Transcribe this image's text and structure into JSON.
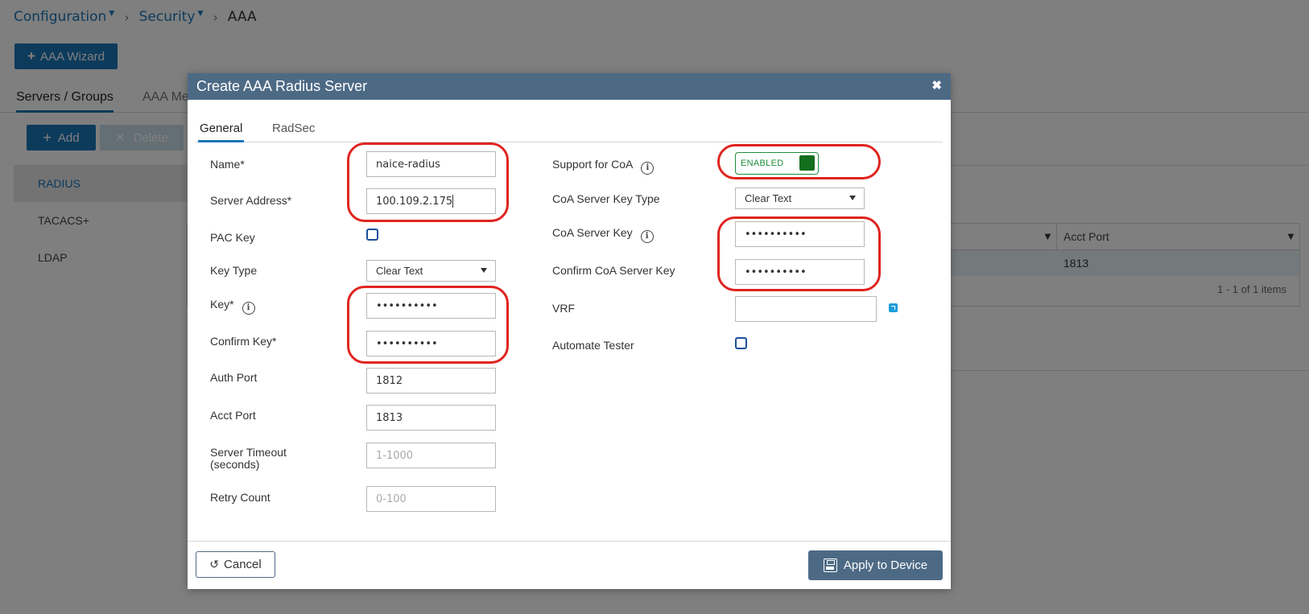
{
  "breadcrumb": {
    "items": [
      {
        "label": "Configuration"
      },
      {
        "label": "Security"
      }
    ],
    "current": "AAA"
  },
  "toolbar": {
    "wizard_label": "AAA Wizard"
  },
  "main_tabs": [
    {
      "label": "Servers / Groups"
    },
    {
      "label": "AAA Me"
    }
  ],
  "actions": {
    "add_label": "Add",
    "delete_label": "Delete"
  },
  "sidebar": {
    "items": [
      {
        "label": "RADIUS"
      },
      {
        "label": "TACACS+"
      },
      {
        "label": "LDAP"
      }
    ]
  },
  "grid": {
    "columns": [
      "Acct Port"
    ],
    "rows": [
      {
        "acct_port": "1813"
      }
    ],
    "pager": "1 - 1 of 1 items"
  },
  "modal": {
    "title": "Create AAA Radius Server",
    "tabs": [
      {
        "label": "General"
      },
      {
        "label": "RadSec"
      }
    ],
    "fields": {
      "name": {
        "label": "Name*",
        "value": "naice-radius"
      },
      "server_address": {
        "label": "Server Address*",
        "value": "100.109.2.175"
      },
      "pac_key": {
        "label": "PAC Key"
      },
      "key_type": {
        "label": "Key Type",
        "value": "Clear Text"
      },
      "key": {
        "label": "Key*",
        "value": "••••••••••"
      },
      "confirm_key": {
        "label": "Confirm Key*",
        "value": "••••••••••"
      },
      "auth_port": {
        "label": "Auth Port",
        "value": "1812"
      },
      "acct_port": {
        "label": "Acct Port",
        "value": "1813"
      },
      "server_timeout": {
        "label_line1": "Server Timeout",
        "label_line2": "(seconds)",
        "placeholder": "1-1000"
      },
      "retry_count": {
        "label": "Retry Count",
        "placeholder": "0-100"
      },
      "support_coa": {
        "label": "Support for CoA",
        "value": "ENABLED"
      },
      "coa_key_type": {
        "label": "CoA Server Key Type",
        "value": "Clear Text"
      },
      "coa_key": {
        "label": "CoA Server Key",
        "value": "••••••••••"
      },
      "confirm_coa_key": {
        "label": "Confirm CoA Server Key",
        "value": "••••••••••"
      },
      "vrf": {
        "label": "VRF",
        "value": ""
      },
      "automate_tester": {
        "label": "Automate Tester"
      }
    },
    "footer": {
      "cancel_label": "Cancel",
      "apply_label": "Apply to Device"
    }
  },
  "colors": {
    "primary": "#1b77b8",
    "modal_header": "#4d6a85",
    "highlight": "#e02420",
    "enabled": "#1e8d3a"
  },
  "icons": {
    "close": "close-icon",
    "info": "info-icon",
    "cancel": "undo-icon",
    "apply": "save-icon",
    "filter": "filter-icon",
    "vrf": "external-link-icon"
  }
}
